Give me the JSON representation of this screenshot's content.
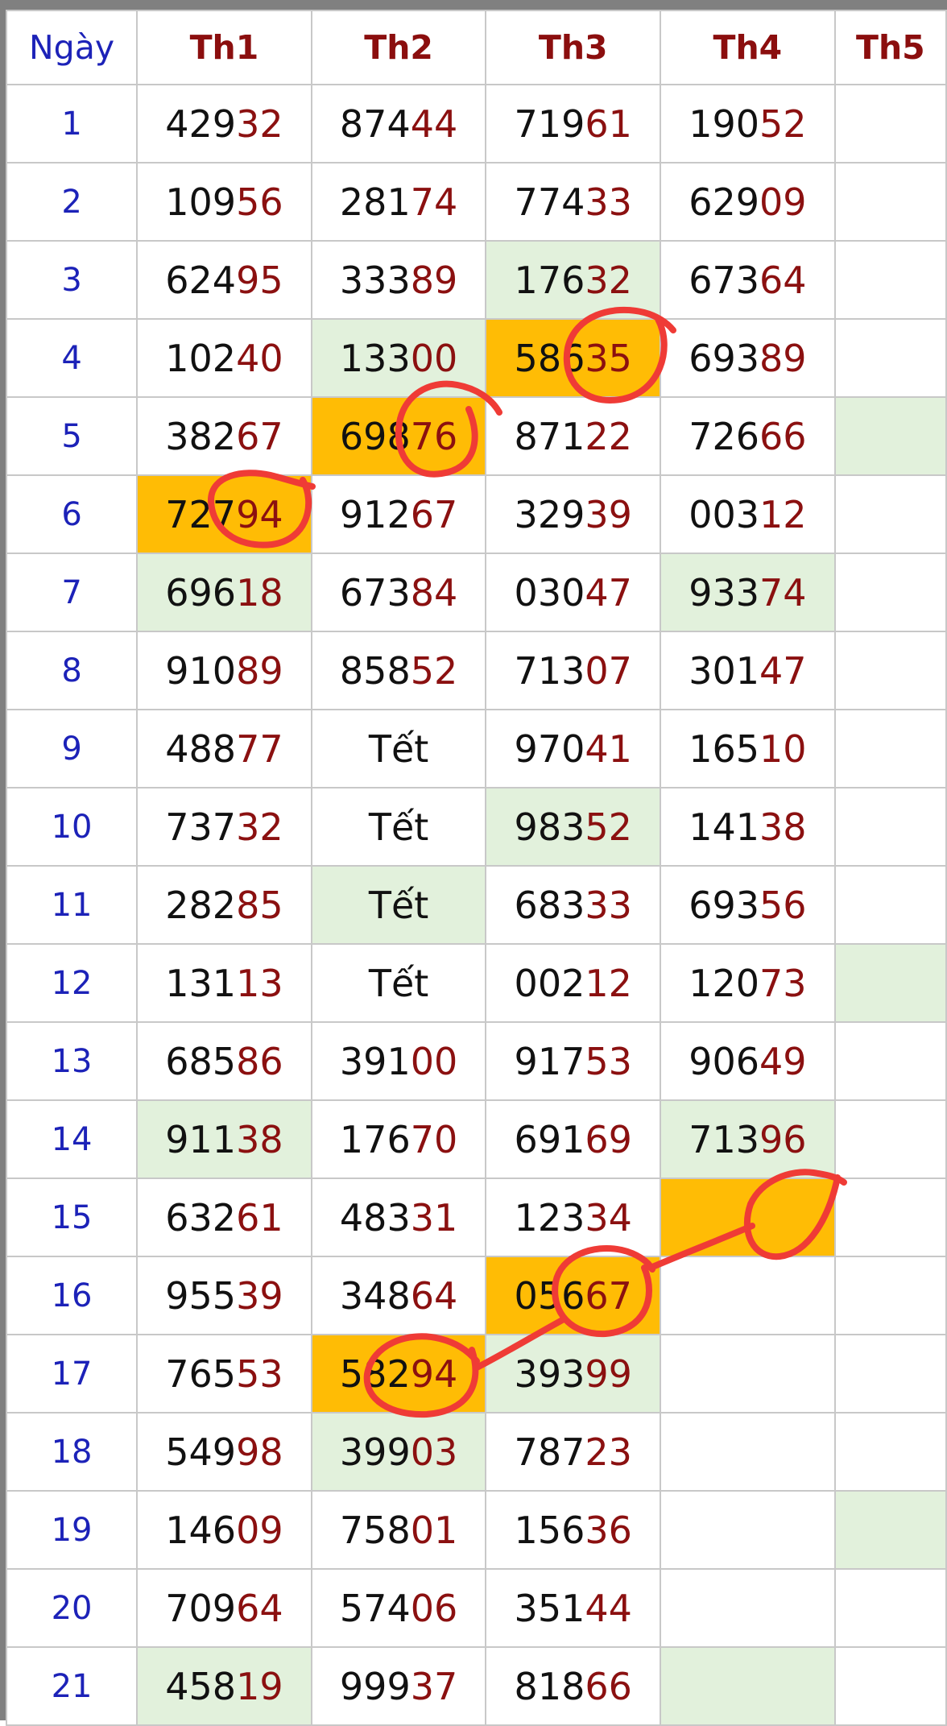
{
  "header": [
    "Ngày",
    "Th1",
    "Th2",
    "Th3",
    "Th4",
    "Th5"
  ],
  "rows": [
    {
      "day": "1",
      "cells": [
        "42932",
        "87444",
        "71961",
        "19052",
        ""
      ]
    },
    {
      "day": "2",
      "cells": [
        "10956",
        "28174",
        "77433",
        "62909",
        ""
      ]
    },
    {
      "day": "3",
      "cells": [
        "62495",
        "33389",
        "17632",
        "67364",
        ""
      ]
    },
    {
      "day": "4",
      "cells": [
        "10240",
        "13300",
        "58635",
        "69389",
        ""
      ]
    },
    {
      "day": "5",
      "cells": [
        "38267",
        "69876",
        "87122",
        "72666",
        ""
      ]
    },
    {
      "day": "6",
      "cells": [
        "72794",
        "91267",
        "32939",
        "00312",
        ""
      ]
    },
    {
      "day": "7",
      "cells": [
        "69618",
        "67384",
        "03047",
        "93374",
        ""
      ]
    },
    {
      "day": "8",
      "cells": [
        "91089",
        "85852",
        "71307",
        "30147",
        ""
      ]
    },
    {
      "day": "9",
      "cells": [
        "48877",
        "Tết",
        "97041",
        "16510",
        ""
      ]
    },
    {
      "day": "10",
      "cells": [
        "73732",
        "Tết",
        "98352",
        "14138",
        ""
      ]
    },
    {
      "day": "11",
      "cells": [
        "28285",
        "Tết",
        "68333",
        "69356",
        ""
      ]
    },
    {
      "day": "12",
      "cells": [
        "13113",
        "Tết",
        "00212",
        "12073",
        ""
      ]
    },
    {
      "day": "13",
      "cells": [
        "68586",
        "39100",
        "91753",
        "90649",
        ""
      ]
    },
    {
      "day": "14",
      "cells": [
        "91138",
        "17670",
        "69169",
        "71396",
        ""
      ]
    },
    {
      "day": "15",
      "cells": [
        "63261",
        "48331",
        "12334",
        "",
        ""
      ]
    },
    {
      "day": "16",
      "cells": [
        "95539",
        "34864",
        "05667",
        "",
        ""
      ]
    },
    {
      "day": "17",
      "cells": [
        "76553",
        "58294",
        "39399",
        "",
        ""
      ]
    },
    {
      "day": "18",
      "cells": [
        "54998",
        "39903",
        "78723",
        "",
        ""
      ]
    },
    {
      "day": "19",
      "cells": [
        "14609",
        "75801",
        "15636",
        "",
        ""
      ]
    },
    {
      "day": "20",
      "cells": [
        "70964",
        "57406",
        "35144",
        "",
        ""
      ]
    },
    {
      "day": "21",
      "cells": [
        "45819",
        "99937",
        "81866",
        "",
        ""
      ]
    }
  ],
  "colors": {
    "highlight_green": "#e2f1dc",
    "highlight_gold": "#ffbc05",
    "header_red": "#8b0e0e",
    "day_blue": "#1c22b8",
    "tail_red": "#8b1010",
    "annotation_red": "#ef3b36"
  }
}
